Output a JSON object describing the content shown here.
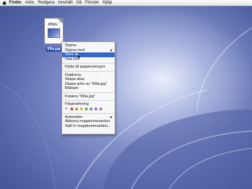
{
  "menubar": {
    "items": [
      {
        "label": "Finder",
        "bold": true
      },
      {
        "label": "Arkiv"
      },
      {
        "label": "Redigera"
      },
      {
        "label": "Innehåll"
      },
      {
        "label": "Gå"
      },
      {
        "label": "Fönster"
      },
      {
        "label": "Hjälp"
      }
    ]
  },
  "desktop_icon": {
    "badge": "JPEG",
    "label": "69ta.jpg"
  },
  "context_menu": {
    "items": [
      {
        "label": "Öppna"
      },
      {
        "label": "Öppna med",
        "submenu": true
      },
      {
        "label": "Skriv ut",
        "selected": true
      },
      {
        "label": "Visa info"
      },
      {
        "separator": true
      },
      {
        "label": "Flytta till papperskorgen"
      },
      {
        "separator": true
      },
      {
        "label": "Duplicera"
      },
      {
        "label": "Skapa alias"
      },
      {
        "label": "Skapa arkiv av \"69ta.jpg\""
      },
      {
        "label": "Bildspel"
      },
      {
        "separator": true
      },
      {
        "label": "Kopiera \"69ta.jpg\""
      },
      {
        "separator": true
      },
      {
        "label": "Färgmärkning:"
      },
      {
        "colors": true
      },
      {
        "separator": true
      },
      {
        "label": "Automator",
        "submenu": true
      },
      {
        "label": "Aktivera mappkommandon"
      },
      {
        "label": "Ställ in mappkommandon..."
      }
    ],
    "label_colors": [
      "#e8524a",
      "#f2a23a",
      "#f2df4a",
      "#7bc95a",
      "#6fa2e8",
      "#b782d6",
      "#a9a9a9"
    ],
    "no_color_symbol": "✕"
  }
}
